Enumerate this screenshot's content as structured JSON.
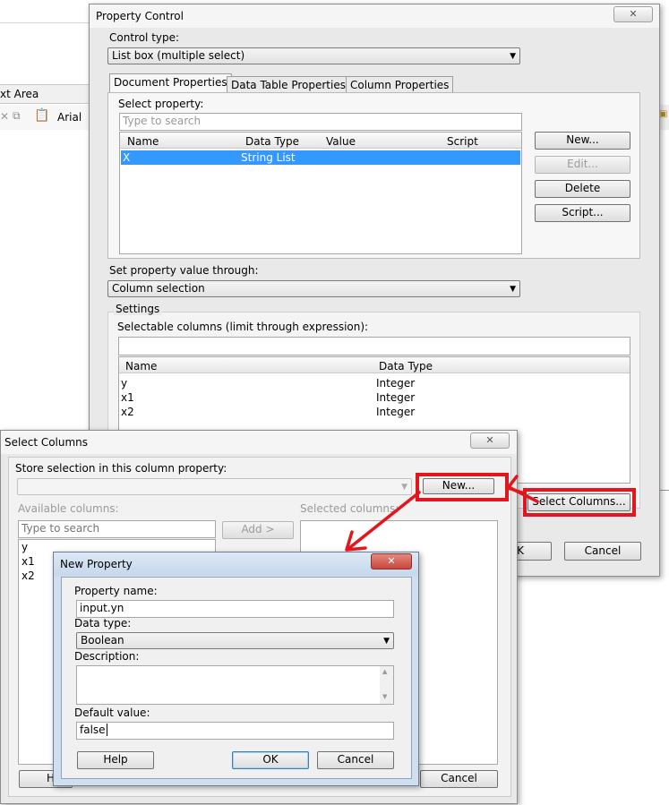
{
  "background_app": {
    "text_area_label": "xt Area",
    "font_value": "Arial"
  },
  "property_control": {
    "title": "Property Control",
    "control_type_label": "Control type:",
    "control_type_value": "List box (multiple select)",
    "tabs": [
      "Document Properties",
      "Data Table Properties",
      "Column Properties"
    ],
    "select_property_label": "Select property:",
    "search_placeholder": "Type to search",
    "table_headers": [
      "Name",
      "Data Type",
      "Value",
      "Script"
    ],
    "rows": [
      {
        "name": "X",
        "type": "String List",
        "value": "",
        "script": ""
      }
    ],
    "buttons": {
      "new": "New...",
      "edit": "Edit...",
      "delete": "Delete",
      "script": "Script..."
    },
    "set_value_label": "Set property value through:",
    "set_value_value": "Column selection",
    "settings_label": "Settings",
    "selectable_label": "Selectable columns (limit through expression):",
    "col_headers": [
      "Name",
      "Data Type"
    ],
    "col_rows": [
      {
        "name": "y",
        "type": "Integer"
      },
      {
        "name": "x1",
        "type": "Integer"
      },
      {
        "name": "x2",
        "type": "Integer"
      }
    ],
    "select_columns_btn": "Select Columns...",
    "ok_partial": "K",
    "cancel": "Cancel"
  },
  "select_columns": {
    "title": "Select Columns",
    "store_label": "Store selection in this column property:",
    "new_btn": "New...",
    "available_label": "Available columns:",
    "selected_label": "Selected columns:",
    "search_placeholder": "Type to search",
    "add_btn": "Add >",
    "columns": [
      "y",
      "x1",
      "x2"
    ],
    "help_partial": "H",
    "cancel": "Cancel"
  },
  "new_property": {
    "title": "New Property",
    "name_label": "Property name:",
    "name_value": "input.yn",
    "type_label": "Data type:",
    "type_value": "Boolean",
    "desc_label": "Description:",
    "default_label": "Default value:",
    "default_value": "false",
    "help": "Help",
    "ok": "OK",
    "cancel": "Cancel"
  },
  "colors": {
    "highlight": "#e4151c",
    "selection": "#3399ff",
    "close_red": "#c9463d"
  }
}
